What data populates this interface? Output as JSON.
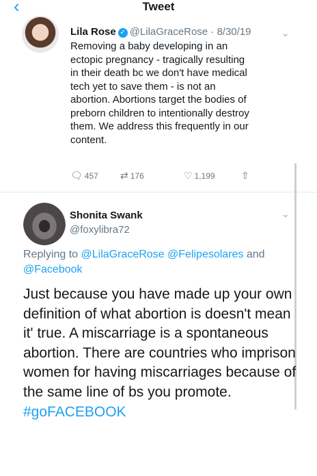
{
  "header": {
    "back_icon": "chevron-left-icon",
    "title": "Tweet"
  },
  "tweet1": {
    "name": "Lila Rose",
    "verified_icon": "verified-badge-icon",
    "handle_time": "@LilaGraceRose · 8/30/19",
    "text": "Removing a baby developing in an\nectopic pregnancy - tragically resulting\nin their death bc we don't have medical\ntech yet to save them - is not an\nabortion. Abortions target the bodies of\npreborn children to intentionally destroy\nthem. We address this frequently in our\ncontent.",
    "actions": {
      "replies": "457",
      "retweets": "176",
      "likes": "1,199"
    }
  },
  "tweet2": {
    "name": "Shonita Swank",
    "handle": "@foxylibra72",
    "replying_prefix": "Replying to",
    "replying_to": "@LilaGraceRose @Felipesolares",
    "replying_and": "and",
    "replying_last": "@Facebook",
    "text": "Just because you have made up your own definition of what abortion is doesn't mean it' true. A miscarriage is a spontaneous abortion. There are countries who imprison women for having miscarriages because of the same line of bs you promote.",
    "hashtag": "#goFACEBOOK"
  },
  "colors": {
    "accent": "#1da1f2",
    "muted": "#657786"
  }
}
